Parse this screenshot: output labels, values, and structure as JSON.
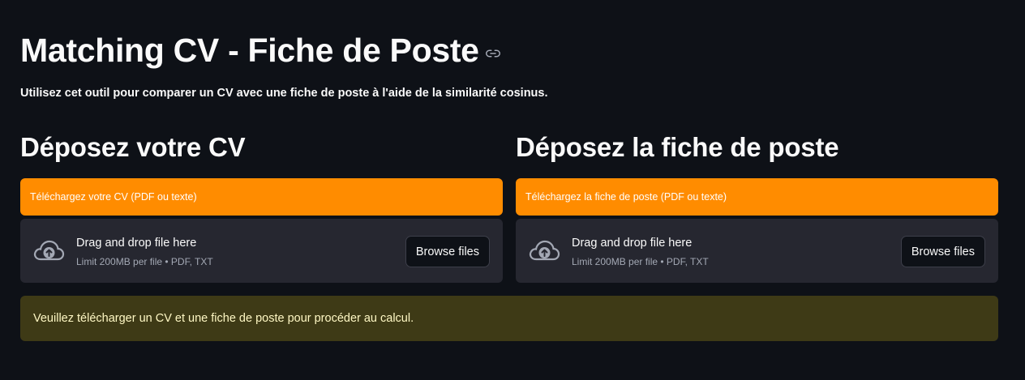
{
  "header": {
    "title": "Matching CV - Fiche de Poste",
    "subtitle": "Utilisez cet outil pour comparer un CV avec une fiche de poste à l'aide de la similarité cosinus."
  },
  "uploaders": [
    {
      "heading": "Déposez votre CV",
      "label": "Téléchargez votre CV (PDF ou texte)",
      "dropzone_text": "Drag and drop file here",
      "limit_text": "Limit 200MB per file • PDF, TXT",
      "button_label": "Browse files"
    },
    {
      "heading": "Déposez la fiche de poste",
      "label": "Téléchargez la fiche de poste (PDF ou texte)",
      "dropzone_text": "Drag and drop file here",
      "limit_text": "Limit 200MB per file • PDF, TXT",
      "button_label": "Browse files"
    }
  ],
  "warning": {
    "message": "Veuillez télécharger un CV et une fiche de poste pour procéder au calcul."
  },
  "colors": {
    "background": "#0e1117",
    "label_accent": "#ff8c00",
    "dropzone_bg": "#262730",
    "warning_bg": "#3e3a16",
    "warning_text": "#fff8c4"
  },
  "icons": {
    "title_anchor": "link-icon",
    "upload": "cloud-upload-icon"
  }
}
